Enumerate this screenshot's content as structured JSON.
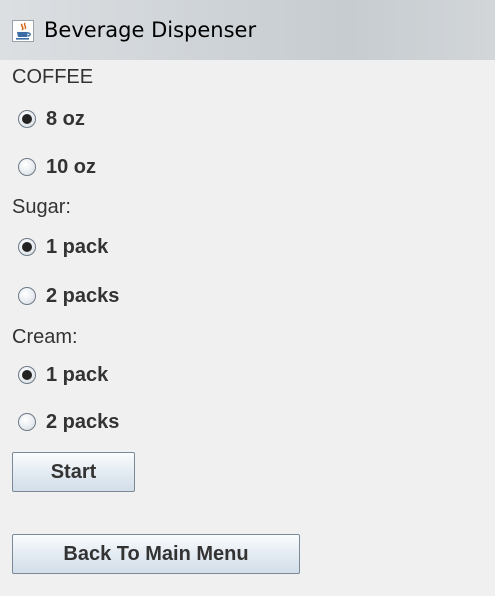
{
  "window": {
    "title": "Beverage Dispenser",
    "icon": "java-cup-icon"
  },
  "coffee": {
    "label": "COFFEE",
    "options": [
      "8 oz",
      "10 oz"
    ],
    "selected": "8 oz"
  },
  "sugar": {
    "label": "Sugar:",
    "options": [
      "1 pack",
      "2 packs"
    ],
    "selected": "1 pack"
  },
  "cream": {
    "label": "Cream:",
    "options": [
      "1 pack",
      "2 packs"
    ],
    "selected": "1 pack"
  },
  "buttons": {
    "start": "Start",
    "back": "Back To Main Menu"
  }
}
